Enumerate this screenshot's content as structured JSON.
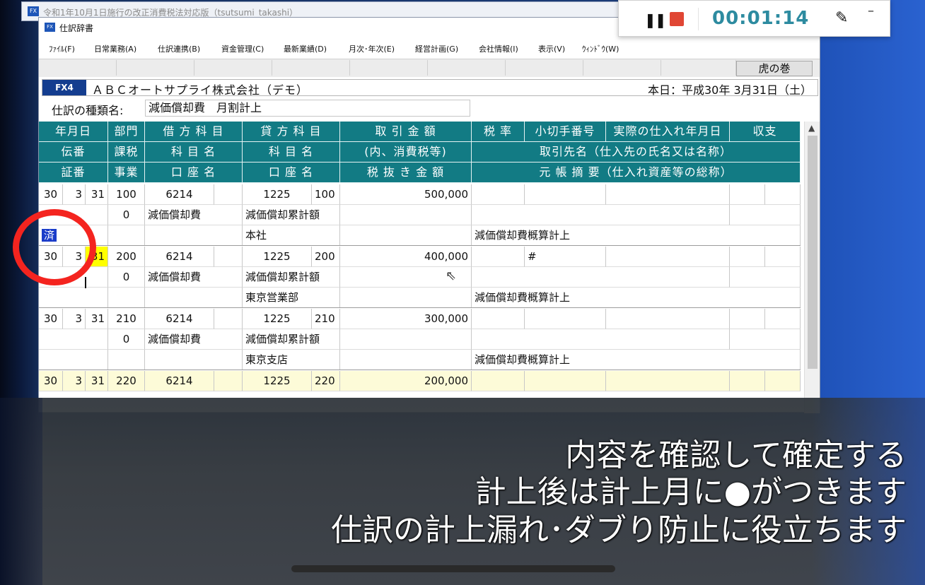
{
  "back_window": {
    "title": "令和1年10月1日施行の改正消費税法対応版（tsutsumi_takashi）",
    "app_icon": "FX"
  },
  "window": {
    "title": "仕訳辞書",
    "app_icon": "FX",
    "menu": [
      "ﾌｧｲﾙ(F)",
      "日常業務(A)",
      "仕訳連携(B)",
      "資金管理(C)",
      "最新業績(D)",
      "月次･年次(E)",
      "経営計画(G)",
      "会社情報(I)",
      "表示(V)",
      "ｳｨﾝﾄﾞｳ(W)"
    ],
    "toolbar_button": "虎の巻"
  },
  "company_bar": {
    "badge": "FX4",
    "name": "ＡＢＣオートサプライ株式会社（デモ）",
    "today": "本日：平成30年 3月31日（土）"
  },
  "journal_type": {
    "label": "仕訳の種類名:",
    "value": "減価償却費　月割計上"
  },
  "grid": {
    "header_row1": [
      "年月日",
      "部門",
      "借 方 科 目",
      "貸 方 科 目",
      "取 引 金 額",
      "税 率",
      "小切手番号",
      "実際の仕入れ年月日",
      "収支"
    ],
    "header_row2": [
      "伝番",
      "課税",
      "科 目 名",
      "科 目 名",
      "(内、消費税等)",
      "取引先名（仕入先の氏名又は名称）"
    ],
    "header_row3": [
      "証番",
      "事業",
      "口 座 名",
      "口 座 名",
      "税 抜 き 金 額",
      "元 帳 摘 要（仕入れ資産等の総称）"
    ],
    "entries": [
      {
        "y": "30",
        "m": "3",
        "d": "31",
        "dept": "100",
        "debit_code": "6214",
        "credit_code": "1225",
        "credit_dept": "100",
        "amount": "500,000",
        "tax_flag": "0",
        "debit_name": "減価償却費",
        "credit_name": "減価償却累計額",
        "status": "済",
        "credit_account": "本社",
        "memo": "減価償却費概算計上",
        "check_no": ""
      },
      {
        "y": "30",
        "m": "3",
        "d": "31",
        "dept": "200",
        "debit_code": "6214",
        "credit_code": "1225",
        "credit_dept": "200",
        "amount": "400,000",
        "tax_flag": "0",
        "debit_name": "減価償却費",
        "credit_name": "減価償却累計額",
        "status": "",
        "credit_account": "東京営業部",
        "memo": "減価償却費概算計上",
        "check_no": "#"
      },
      {
        "y": "30",
        "m": "3",
        "d": "31",
        "dept": "210",
        "debit_code": "6214",
        "credit_code": "1225",
        "credit_dept": "210",
        "amount": "300,000",
        "tax_flag": "0",
        "debit_name": "減価償却費",
        "credit_name": "減価償却累計額",
        "status": "",
        "credit_account": "東京支店",
        "memo": "減価償却費概算計上",
        "check_no": ""
      },
      {
        "y": "30",
        "m": "3",
        "d": "31",
        "dept": "220",
        "debit_code": "6214",
        "credit_code": "1225",
        "credit_dept": "220",
        "amount": "200,000",
        "tax_flag": "",
        "debit_name": "",
        "credit_name": "",
        "status": "",
        "credit_account": "",
        "memo": "",
        "check_no": ""
      }
    ]
  },
  "recorder": {
    "timer": "00:01:14",
    "pause_icon": "pause-icon",
    "stop_icon": "stop-icon",
    "pen_icon": "pen-icon",
    "minimize": "–"
  },
  "captions": [
    "内容を確認して確定する",
    "計上後は計上月に●がつきます",
    "仕訳の計上漏れ･ダブり防止に役立ちます"
  ],
  "colors": {
    "header_teal": "#127b84",
    "badge_navy": "#143d8f",
    "highlight_row": "#fdfbd8",
    "annotation_red": "#f4241f",
    "timer": "#2d8ba0"
  }
}
